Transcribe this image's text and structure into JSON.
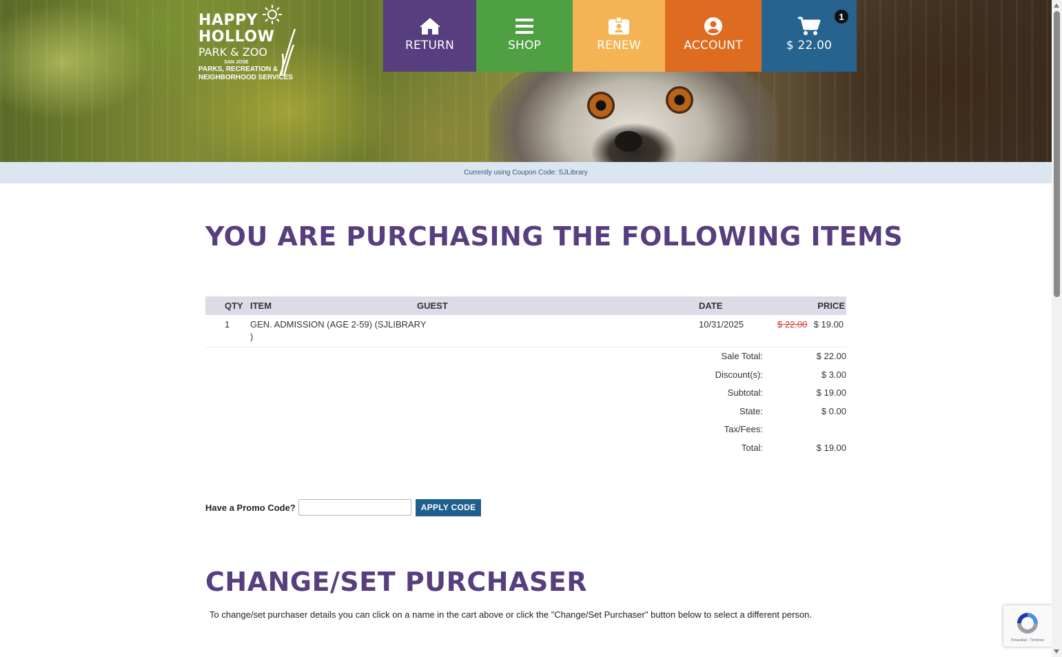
{
  "logo": {
    "line1": "HAPPY",
    "line2": "HOLLOW",
    "line3": "PARK & ZOO",
    "line4": "SAN JOSE",
    "line5": "PARKS, RECREATION &",
    "line6": "NEIGHBORHOOD SERVICES"
  },
  "nav": {
    "return_label": "RETURN",
    "shop_label": "SHOP",
    "renew_label": "RENEW",
    "account_label": "ACCOUNT",
    "cart_label": "$ 22.00",
    "cart_count": "1"
  },
  "coupon_bar": "Currently using Coupon Code: SJLibrary",
  "purchase_heading": "YOU ARE PURCHASING THE FOLLOWING ITEMS",
  "table": {
    "headers": {
      "qty": "QTY",
      "item": "ITEM",
      "guest": "GUEST",
      "date": "DATE",
      "price": "PRICE"
    },
    "rows": [
      {
        "qty": "1",
        "item_line1": "GEN. ADMISSION (AGE 2-59) (SJLIBRARY",
        "item_line2": ")",
        "guest": "",
        "date": "10/31/2025",
        "original_price": "$ 22.00",
        "price": "$ 19.00"
      }
    ]
  },
  "totals": [
    {
      "label": "Sale Total:",
      "value": "$ 22.00"
    },
    {
      "label": "Discount(s):",
      "value": "$ 3.00"
    },
    {
      "label": "Subtotal:",
      "value": "$ 19.00"
    },
    {
      "label": "State:",
      "value": "$ 0.00"
    },
    {
      "label": "Tax/Fees:",
      "value": ""
    },
    {
      "label": "Total:",
      "value": "$ 19.00"
    }
  ],
  "promo": {
    "label": "Have a Promo Code?",
    "input_value": "",
    "placeholder": "",
    "button_label": "APPLY CODE"
  },
  "change_heading": "CHANGE/SET PURCHASER",
  "change_text": "To change/set purchaser details you can click on a name in the cart above or click the \"Change/Set Purchaser\" button below to select a different person.",
  "recaptcha": {
    "links": "Privacidad - Términos"
  },
  "colors": {
    "purple": "#573e7f",
    "green": "#4ea042",
    "yellow": "#f4b453",
    "orange": "#de6c20",
    "blue": "#26638e",
    "strike_red": "#d9342b"
  }
}
